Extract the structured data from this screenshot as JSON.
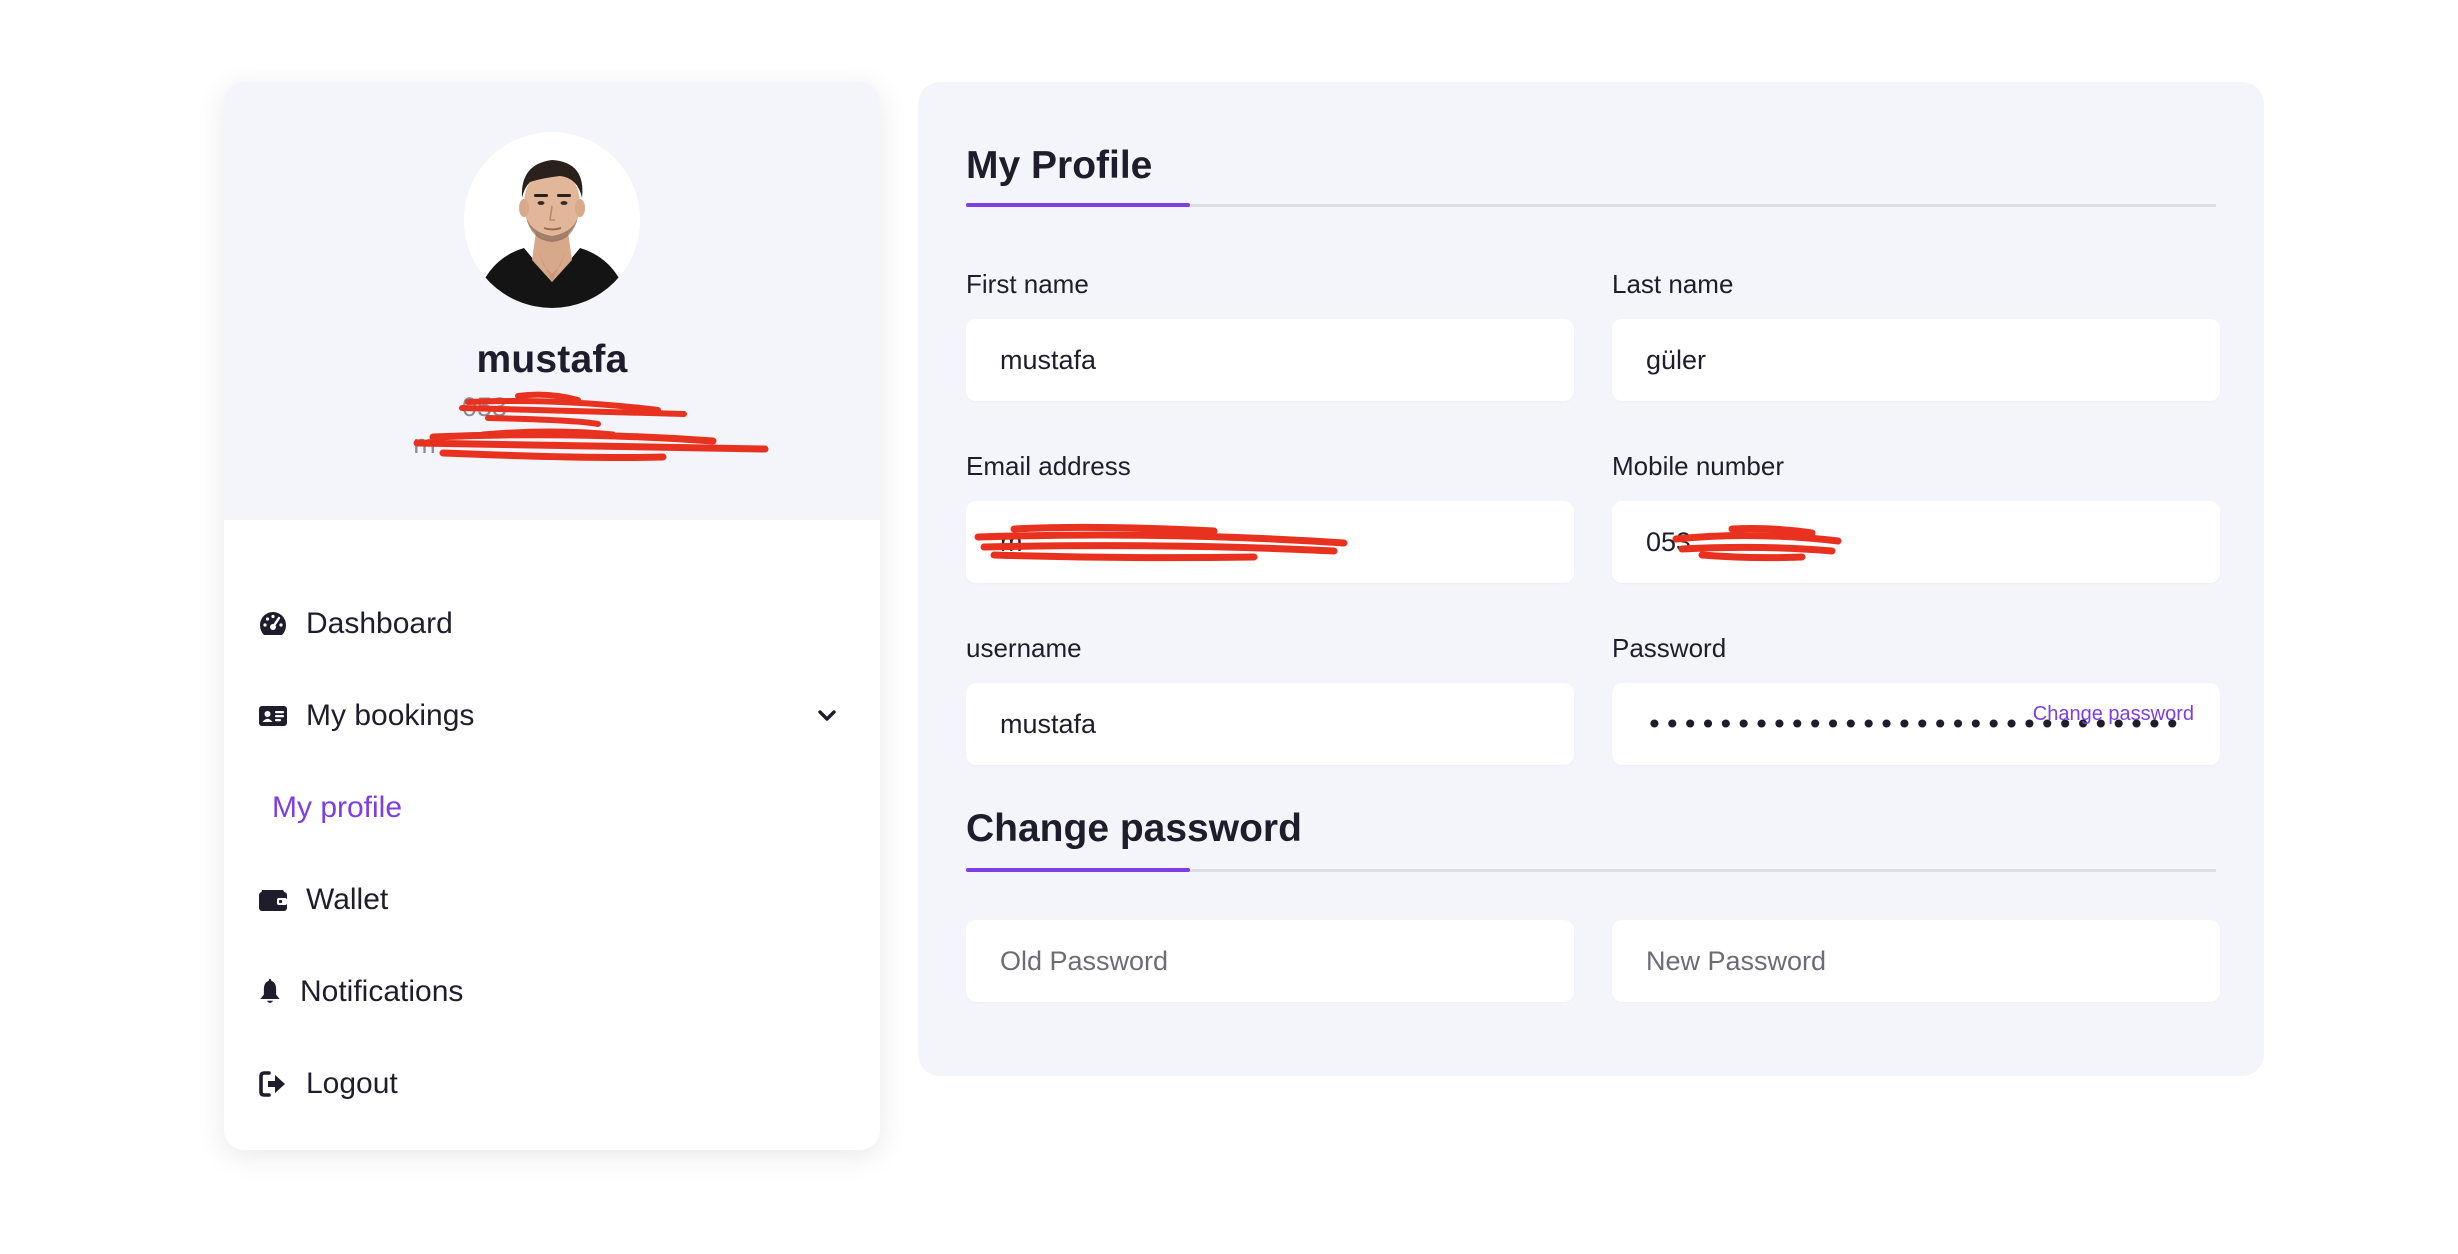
{
  "user": {
    "name": "mustafa",
    "phone": "053",
    "email": "m",
    "avatar_alt": "avatar"
  },
  "menu": {
    "dashboard": "Dashboard",
    "my_bookings": "My bookings",
    "my_profile": "My profile",
    "wallet": "Wallet",
    "notifications": "Notifications",
    "logout": "Logout"
  },
  "profile": {
    "title": "My Profile",
    "first_name_label": "First name",
    "first_name_value": "mustafa",
    "last_name_label": "Last name",
    "last_name_value": "güler",
    "email_label": "Email address",
    "email_value": "m",
    "mobile_label": "Mobile number",
    "mobile_value": "053",
    "username_label": "username",
    "username_value": "mustafa",
    "password_label": "Password",
    "password_value": "•••••••••••••••••••••••••••••••••••••••••••",
    "change_password_link": "Change password"
  },
  "change_password": {
    "title": "Change password",
    "old_placeholder": "Old Password",
    "new_placeholder": "New Password"
  },
  "colors": {
    "accent": "#7b3fe4",
    "panel_bg": "#f4f5fa",
    "text": "#1f1d2b",
    "redaction": "#e8321f"
  }
}
